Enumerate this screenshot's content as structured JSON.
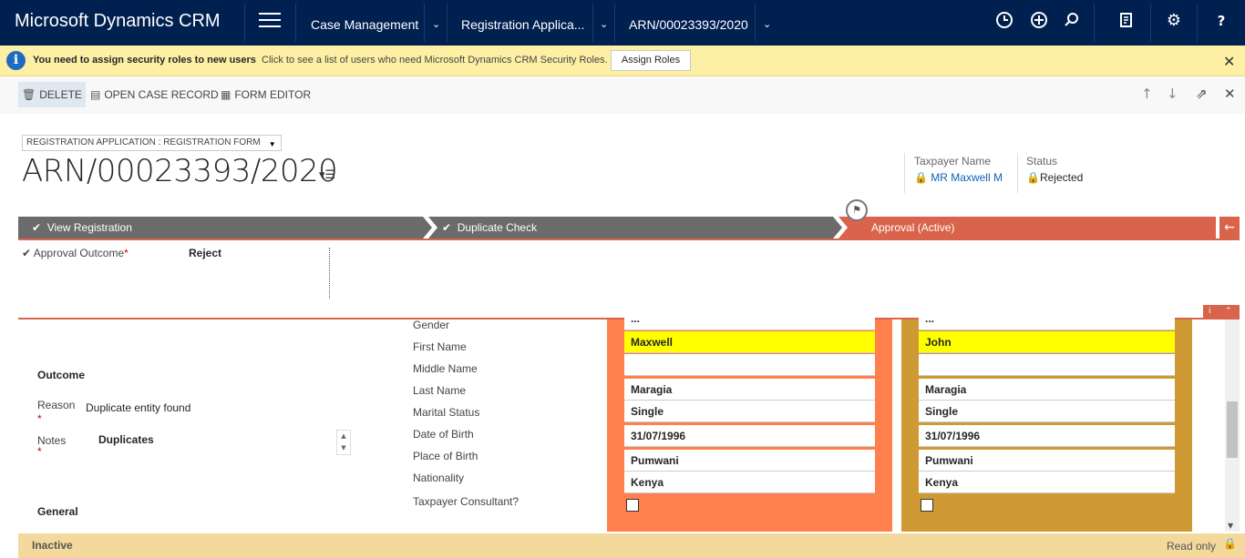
{
  "nav": {
    "app_title": "Microsoft Dynamics CRM",
    "area": "Case Management",
    "entity": "Registration Applica...",
    "record": "ARN/00023393/2020"
  },
  "notification": {
    "bold": "You need to assign security roles to new users",
    "message": "Click to see a list of users who need Microsoft Dynamics CRM Security Roles.",
    "button": "Assign Roles"
  },
  "commands": {
    "delete": "DELETE",
    "open_case": "OPEN CASE RECORD",
    "form_editor": "FORM EDITOR"
  },
  "header": {
    "form_selector": "REGISTRATION APPLICATION : REGISTRATION FORM",
    "title": "ARN/00023393/2020",
    "taxpayer_label": "Taxpayer Name",
    "taxpayer_value": "MR Maxwell M",
    "status_label": "Status",
    "status_value": "Rejected"
  },
  "process": {
    "stages": [
      "View Registration",
      "Duplicate Check",
      "Approval (Active)"
    ],
    "field_label": "Approval Outcome",
    "field_value": "Reject"
  },
  "outcome": {
    "section": "Outcome",
    "reason_label": "Reason",
    "reason_value": "Duplicate entity found",
    "notes_label": "Notes",
    "notes_value": "Duplicates",
    "general_section": "General"
  },
  "compare": {
    "labels": [
      "Gender",
      "First Name",
      "Middle Name",
      "Last Name",
      "Marital Status",
      "Date of Birth",
      "Place of Birth",
      "Nationality",
      "Taxpayer Consultant?"
    ],
    "left": [
      "...",
      "Maxwell",
      "",
      "Maragia",
      "Single",
      "31/07/1996",
      "Pumwani",
      "Kenya"
    ],
    "right": [
      "...",
      "John",
      "",
      "Maragia",
      "Single",
      "31/07/1996",
      "Pumwani",
      "Kenya"
    ],
    "left_color": "#ff7f4d",
    "right_color": "#cf9a34",
    "highlight_color": "#ffff00"
  },
  "footer": {
    "status": "Inactive",
    "mode": "Read only"
  },
  "colors": {
    "nav_bg": "#002050",
    "notif_bg": "#fdf0a5",
    "stage_done": "#6b6b6b",
    "stage_active": "#d9634b",
    "footer_bg": "#f4d99c"
  }
}
